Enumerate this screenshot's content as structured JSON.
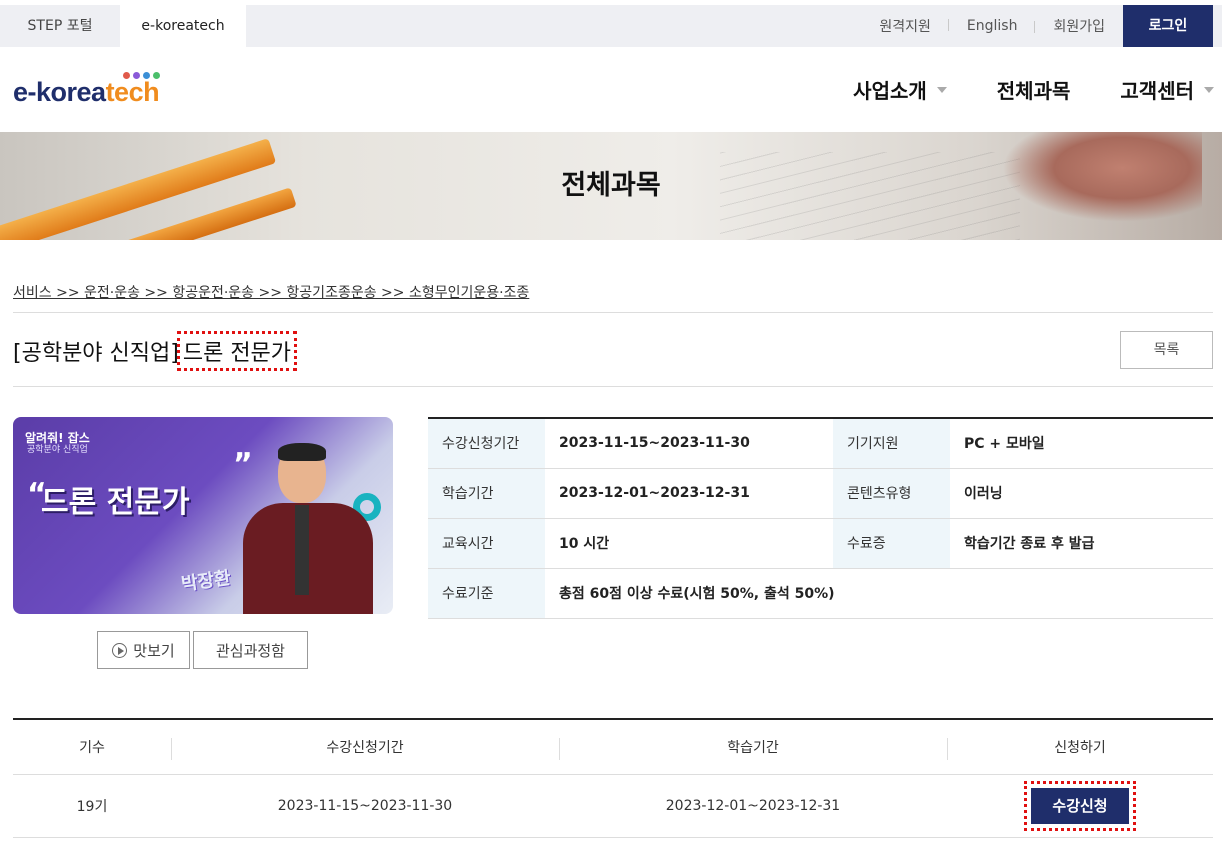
{
  "topbar": {
    "tabs": [
      "STEP 포털",
      "e-koreatech"
    ],
    "links": [
      "원격지원",
      "English",
      "회원가입"
    ],
    "login": "로그인"
  },
  "header": {
    "logo_part1": "e-korea",
    "logo_part2": "tech",
    "logo_dot_colors": [
      "#e05a4a",
      "#8a5ad8",
      "#3b8fd6",
      "#4bbf6b"
    ],
    "nav": [
      "사업소개",
      "전체과목",
      "고객센터"
    ]
  },
  "hero": {
    "title": "전체과목"
  },
  "breadcrumb": "서비스 >> 운전·운송 >> 항공운전·운송 >> 항공기조종운송 >> 소형무인기운용·조종",
  "course": {
    "prefix": "[공학분야 신직업]",
    "name": "드론 전문가",
    "list_button": "목록"
  },
  "thumbnail": {
    "brand": "알려줘! 잡스",
    "sub": "공학분야 신직업",
    "title": "드론 전문가",
    "instructor": "박장환"
  },
  "buttons": {
    "preview": "맛보기",
    "wishlist": "관심과정함"
  },
  "info": [
    {
      "k1": "수강신청기간",
      "v1": "2023-11-15~2023-11-30",
      "k2": "기기지원",
      "v2": "PC + 모바일"
    },
    {
      "k1": "학습기간",
      "v1": "2023-12-01~2023-12-31",
      "k2": "콘텐츠유형",
      "v2": "이러닝"
    },
    {
      "k1": "교육시간",
      "v1": "10 시간",
      "k2": "수료증",
      "v2": "학습기간 종료 후 발급"
    },
    {
      "k1": "수료기준",
      "v1": "총점 60점 이상 수료(시험 50%, 출석 50%)"
    }
  ],
  "classes": {
    "headers": [
      "기수",
      "수강신청기간",
      "학습기간",
      "신청하기"
    ],
    "rows": [
      {
        "term": "19기",
        "apply_period": "2023-11-15~2023-11-30",
        "study_period": "2023-12-01~2023-12-31",
        "action": "수강신청"
      }
    ]
  }
}
